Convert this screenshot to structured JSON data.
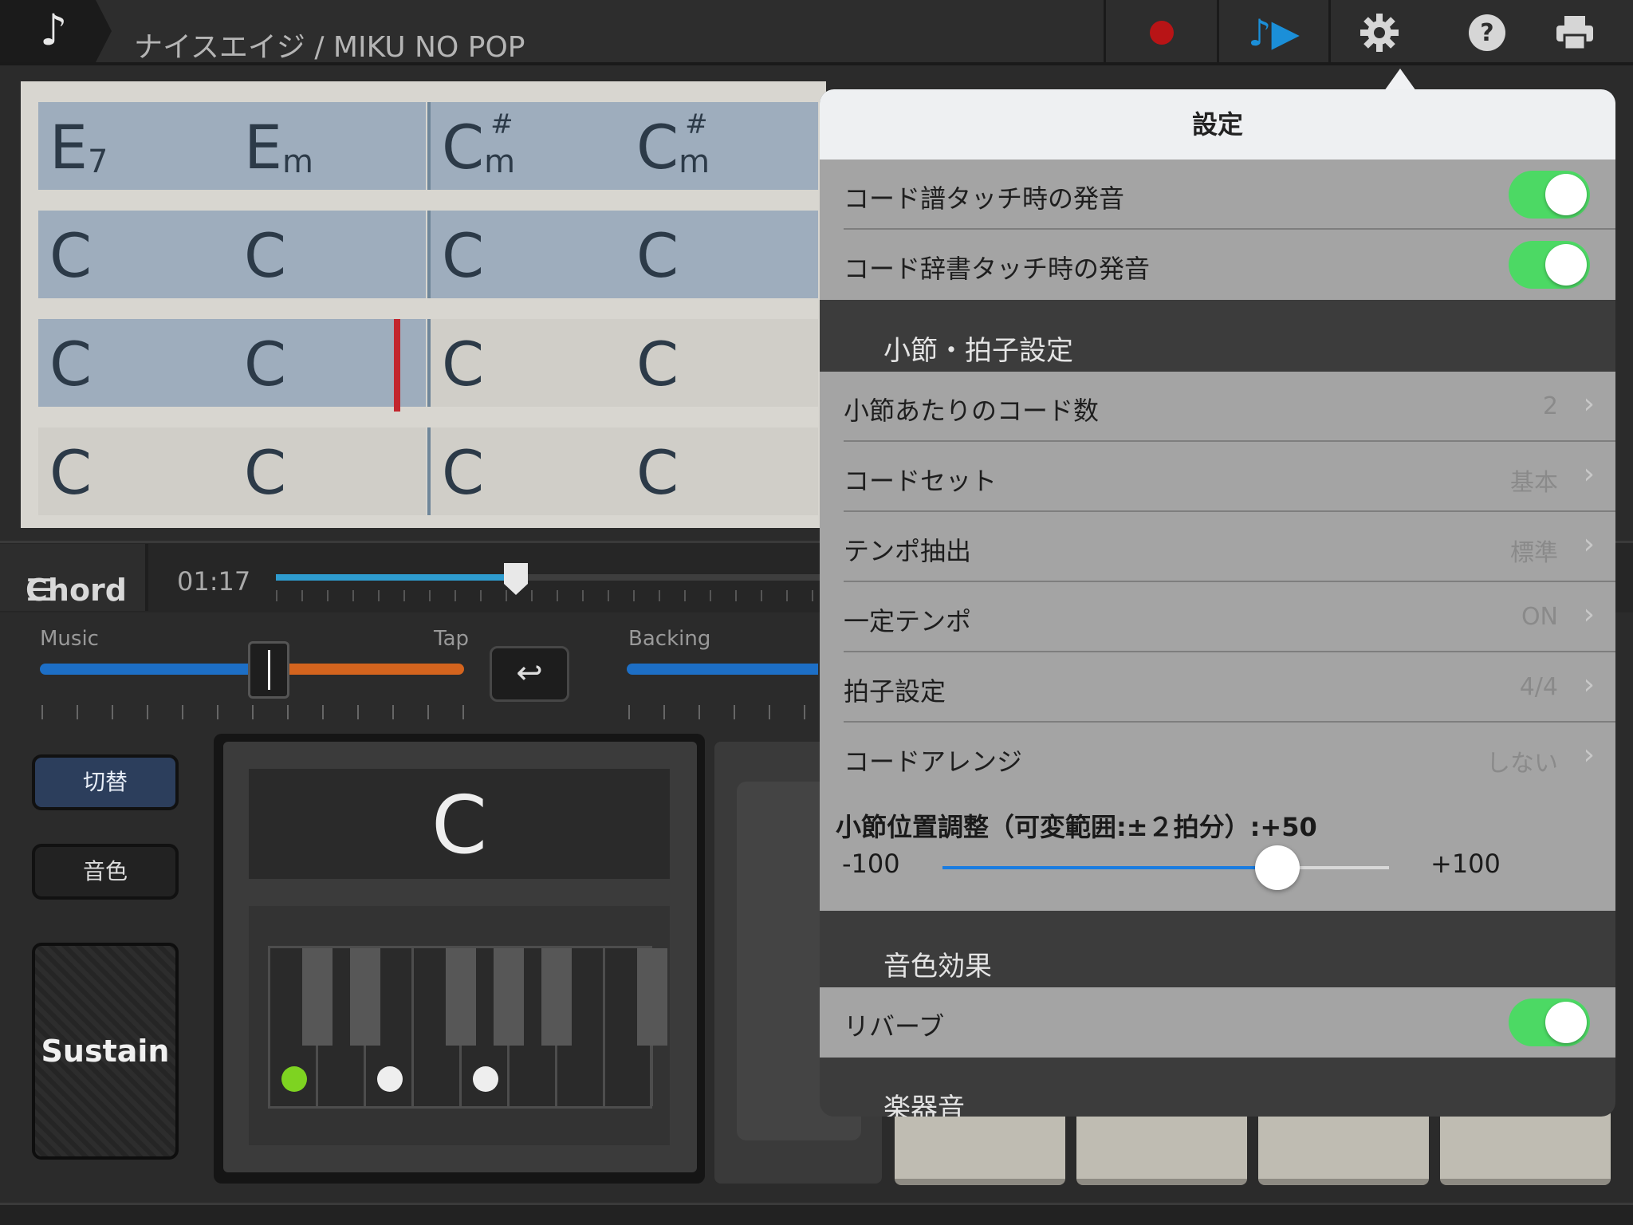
{
  "header": {
    "app_icon": "music-note-icon",
    "song_title": "ナイスエイジ / MIKU NO POP",
    "note_glyph": "♪",
    "play_glyph": "♪▶",
    "accent": "#1b8fd8",
    "record_color": "#b81416"
  },
  "chord_grid": {
    "rows": [
      {
        "chords": [
          {
            "root": "E",
            "sup": "",
            "sub": "7"
          },
          {
            "root": "E",
            "sup": "",
            "sub": "m"
          },
          {
            "root": "C",
            "sup": "#",
            "sub": "m"
          },
          {
            "root": "C",
            "sup": "#",
            "sub": "m"
          }
        ],
        "highlight": [
          true,
          true,
          true,
          true
        ]
      },
      {
        "chords": [
          {
            "root": "C",
            "sup": "",
            "sub": ""
          },
          {
            "root": "C",
            "sup": "",
            "sub": ""
          },
          {
            "root": "C",
            "sup": "",
            "sub": ""
          },
          {
            "root": "C",
            "sup": "",
            "sub": ""
          }
        ],
        "highlight": [
          true,
          true,
          true,
          true
        ]
      },
      {
        "chords": [
          {
            "root": "C",
            "sup": "",
            "sub": ""
          },
          {
            "root": "C",
            "sup": "",
            "sub": ""
          },
          {
            "root": "C",
            "sup": "",
            "sub": ""
          },
          {
            "root": "C",
            "sup": "",
            "sub": ""
          }
        ],
        "highlight": [
          true,
          true,
          false,
          false
        ]
      },
      {
        "chords": [
          {
            "root": "C",
            "sup": "",
            "sub": ""
          },
          {
            "root": "C",
            "sup": "",
            "sub": ""
          },
          {
            "root": "C",
            "sup": "",
            "sub": ""
          },
          {
            "root": "C",
            "sup": "",
            "sub": ""
          }
        ],
        "highlight": [
          false,
          false,
          false,
          false
        ]
      }
    ],
    "highlight_color": "#9eadbd",
    "cursor_color": "#c2262e"
  },
  "transport": {
    "mode_label": "Chord",
    "menu_icon": "menu-icon",
    "time": "01:17",
    "progress": 0.43
  },
  "mixer": {
    "music_label": "Music",
    "tap_label": "Tap",
    "backing_label": "Backing",
    "balance": 0.54,
    "undo_glyph": "↩"
  },
  "side_buttons": {
    "switch": "切替",
    "tone": "音色",
    "sustain": "Sustain"
  },
  "pad": {
    "chord": "C",
    "pressed_keys": [
      {
        "white_index": 0,
        "color": "#7ed321"
      },
      {
        "white_index": 2,
        "color": "#eeeeee"
      },
      {
        "white_index": 4,
        "color": "#eeeeee"
      }
    ]
  },
  "settings": {
    "title": "設定",
    "cells": [
      {
        "label": "コード譜タッチ時の発音",
        "toggle": true
      },
      {
        "label": "コード辞書タッチ時の発音",
        "toggle": true
      }
    ],
    "section_measure": "小節・拍子設定",
    "measure_items": [
      {
        "label": "小節あたりのコード数",
        "value": "2"
      },
      {
        "label": "コードセット",
        "value": "基本"
      },
      {
        "label": "テンポ抽出",
        "value": "標準"
      },
      {
        "label": "一定テンポ",
        "value": "ON"
      },
      {
        "label": "拍子設定",
        "value": "4/4"
      },
      {
        "label": "コードアレンジ",
        "value": "しない"
      }
    ],
    "offset": {
      "title": "小節位置調整（可変範囲:±２拍分）:+50",
      "min_label": "-100",
      "max_label": "+100",
      "value": 50,
      "min": -100,
      "max": 100
    },
    "section_effects": "音色効果",
    "reverb": {
      "label": "リバーブ",
      "toggle": true
    },
    "section_instruments": "楽器音",
    "toggle_on_color": "#4cd964"
  }
}
